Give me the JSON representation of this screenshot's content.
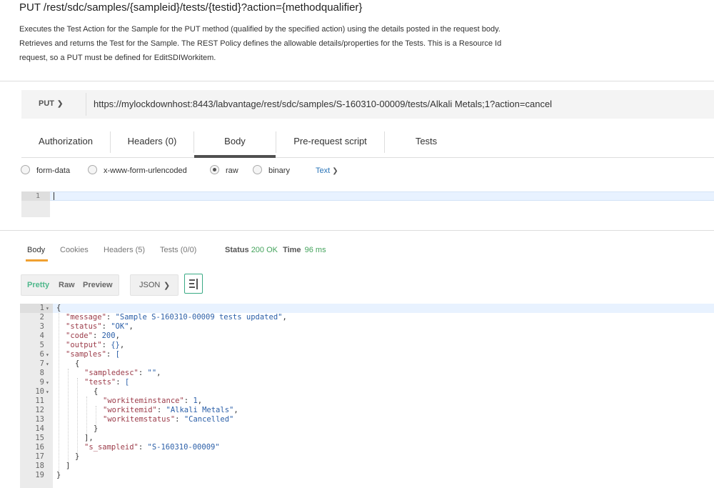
{
  "header": {
    "title": "PUT /rest/sdc/samples/{sampleid}/tests/{testid}?action={methodqualifier}",
    "description_lines": [
      "Executes the Test Action for the Sample for the PUT method (qualified by the specified action) using the details posted in the request body.",
      "Retrieves and returns the Test for the Sample. The REST Policy defines the allowable details/properties for the Tests. This is a Resource Id",
      "request, so a PUT must be defined for EditSDIWorkitem."
    ]
  },
  "request": {
    "method": "PUT",
    "url": "https://mylockdownhost:8443/labvantage/rest/sdc/samples/S-160310-00009/tests/Alkali Metals;1?action=cancel",
    "tabs": [
      "Authorization",
      "Headers (0)",
      "Body",
      "Pre-request script",
      "Tests"
    ],
    "active_tab": "Body",
    "body_modes": [
      "form-data",
      "x-www-form-urlencoded",
      "raw",
      "binary"
    ],
    "selected_mode": "raw",
    "content_type": "Text",
    "editor_line": "1"
  },
  "response": {
    "tabs": [
      "Body",
      "Cookies",
      "Headers (5)",
      "Tests (0/0)"
    ],
    "active_tab": "Body",
    "status_label": "Status",
    "status_value": "200 OK",
    "time_label": "Time",
    "time_value": "96 ms",
    "formats": [
      "Pretty",
      "Raw",
      "Preview"
    ],
    "active_format": "Pretty",
    "language": "JSON",
    "wrap_icon": "wrap-lines-icon",
    "code_lines": [
      {
        "n": "1",
        "fold": true,
        "indent": 0,
        "text": "{"
      },
      {
        "n": "2",
        "fold": false,
        "indent": 1,
        "key": "\"message\"",
        "val": "\"Sample S-160310-00009 tests updated\"",
        "tail": ","
      },
      {
        "n": "3",
        "fold": false,
        "indent": 1,
        "key": "\"status\"",
        "val": "\"OK\"",
        "tail": ","
      },
      {
        "n": "4",
        "fold": false,
        "indent": 1,
        "key": "\"code\"",
        "val": "200",
        "tail": ","
      },
      {
        "n": "5",
        "fold": false,
        "indent": 1,
        "key": "\"output\"",
        "val": "{}",
        "tail": ","
      },
      {
        "n": "6",
        "fold": true,
        "indent": 1,
        "key": "\"samples\"",
        "val": "[",
        "tail": ""
      },
      {
        "n": "7",
        "fold": true,
        "indent": 2,
        "text": "{"
      },
      {
        "n": "8",
        "fold": false,
        "indent": 3,
        "key": "\"sampledesc\"",
        "val": "\"\"",
        "tail": ","
      },
      {
        "n": "9",
        "fold": true,
        "indent": 3,
        "key": "\"tests\"",
        "val": "[",
        "tail": ""
      },
      {
        "n": "10",
        "fold": true,
        "indent": 4,
        "text": "{"
      },
      {
        "n": "11",
        "fold": false,
        "indent": 5,
        "key": "\"workiteminstance\"",
        "val": "1",
        "tail": ","
      },
      {
        "n": "12",
        "fold": false,
        "indent": 5,
        "key": "\"workitemid\"",
        "val": "\"Alkali Metals\"",
        "tail": ","
      },
      {
        "n": "13",
        "fold": false,
        "indent": 5,
        "key": "\"workitemstatus\"",
        "val": "\"Cancelled\"",
        "tail": ""
      },
      {
        "n": "14",
        "fold": false,
        "indent": 4,
        "text": "}"
      },
      {
        "n": "15",
        "fold": false,
        "indent": 3,
        "text": "],"
      },
      {
        "n": "16",
        "fold": false,
        "indent": 3,
        "key": "\"s_sampleid\"",
        "val": "\"S-160310-00009\"",
        "tail": ""
      },
      {
        "n": "17",
        "fold": false,
        "indent": 2,
        "text": "}"
      },
      {
        "n": "18",
        "fold": false,
        "indent": 1,
        "text": "]"
      },
      {
        "n": "19",
        "fold": false,
        "indent": 0,
        "text": "}"
      }
    ]
  }
}
